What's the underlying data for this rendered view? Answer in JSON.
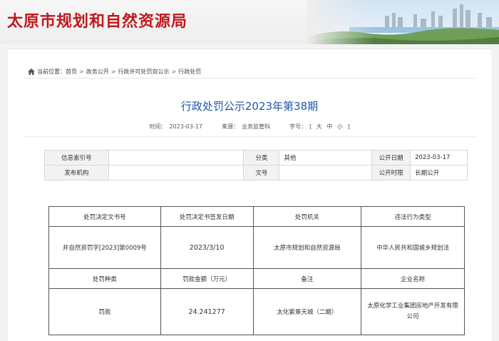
{
  "header": {
    "site_title": "太原市规划和自然资源局"
  },
  "breadcrumb": {
    "prefix": "当前位置：",
    "items": [
      "首页",
      "政务公开",
      "行政许可处罚双公示",
      "行政处罚"
    ],
    "separator": ">"
  },
  "article": {
    "title": "行政处罚公示2023年第38期",
    "time_label": "时间：",
    "time_value": "2023-03-17",
    "source_label": "来源：",
    "source_value": "业务监管科",
    "font_label": "字号：",
    "font_open": "[",
    "font_large": "大",
    "font_medium": "中",
    "font_small": "小",
    "font_close": "]"
  },
  "info_table": {
    "index_label": "信息索引号",
    "index_value": "",
    "category_label": "分类",
    "category_value": "其他",
    "date_label": "公开日期",
    "date_value": "2023-03-17",
    "publisher_label": "发布机构",
    "publisher_value": "",
    "doc_no_label": "文号",
    "doc_no_value": "",
    "period_label": "公开时限",
    "period_value": "长期公开"
  },
  "penalty_table": {
    "headers1": [
      "处罚决定文书号",
      "处罚决定书签发日期",
      "处罚机关",
      "违法行为类型"
    ],
    "row1": [
      "并自然资罚字[2023]第0009号",
      "2023/3/10",
      "太原市规划和自然资源局",
      "中华人民共和国城乡规划法"
    ],
    "headers2": [
      "处罚种类",
      "罚款金额（万元）",
      "备注",
      "企业名称"
    ],
    "row2": [
      "罚款",
      "24.241277",
      "太化紫景天城（二期）",
      "太原化学工业集团房地产开发有限公司"
    ]
  },
  "colors": {
    "brand_red": "#c0181d",
    "title_blue": "#1f56a8"
  }
}
